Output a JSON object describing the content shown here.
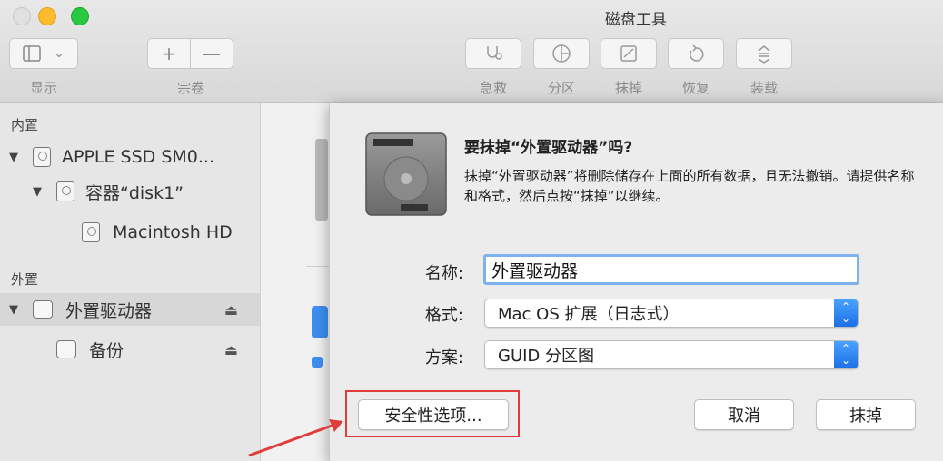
{
  "window": {
    "title": "磁盘工具"
  },
  "toolbar": {
    "view_label": "显示",
    "volume_label": "宗卷",
    "volume_add": "+",
    "volume_remove": "—",
    "first_aid_label": "急救",
    "partition_label": "分区",
    "erase_label": "抹掉",
    "restore_label": "恢复",
    "mount_label": "装载"
  },
  "sidebar": {
    "internal_header": "内置",
    "external_header": "外置",
    "internal_items": [
      {
        "label": "APPLE SSD SM0...",
        "level": 0
      },
      {
        "label": "容器“disk1”",
        "level": 1
      },
      {
        "label": "Macintosh HD",
        "level": 2
      }
    ],
    "external_items": [
      {
        "label": "外置驱动器",
        "level": 0,
        "selected": true,
        "eject": "⏏"
      },
      {
        "label": "备份",
        "level": 1,
        "eject": "⏏"
      }
    ]
  },
  "dialog": {
    "title": "要抹掉“外置驱动器”吗?",
    "message": "抹掉“外置驱动器”将删除储存在上面的所有数据，且无法撤销。请提供名称和格式，然后点按“抹掉”以继续。",
    "name_label": "名称:",
    "name_value": "外置驱动器",
    "format_label": "格式:",
    "format_value": "Mac OS 扩展（日志式）",
    "scheme_label": "方案:",
    "scheme_value": "GUID 分区图",
    "security_button": "安全性选项...",
    "cancel_button": "取消",
    "erase_button": "抹掉"
  },
  "colors": {
    "accent": "#1c6fe6",
    "highlight": "#e03c3c"
  }
}
